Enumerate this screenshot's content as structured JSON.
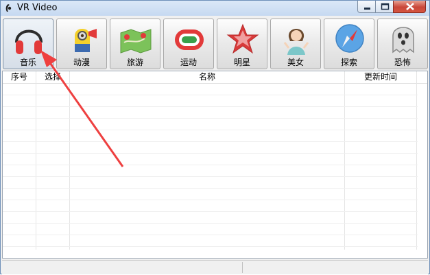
{
  "window": {
    "title": "VR Video"
  },
  "toolbar": {
    "buttons": [
      {
        "label": "音乐",
        "icon": "headphones-icon"
      },
      {
        "label": "动漫",
        "icon": "minion-icon"
      },
      {
        "label": "旅游",
        "icon": "map-icon"
      },
      {
        "label": "运动",
        "icon": "track-icon"
      },
      {
        "label": "明星",
        "icon": "star-icon"
      },
      {
        "label": "美女",
        "icon": "girl-icon"
      },
      {
        "label": "探索",
        "icon": "compass-icon"
      },
      {
        "label": "恐怖",
        "icon": "ghost-icon"
      }
    ]
  },
  "grid": {
    "columns": [
      "序号",
      "选择",
      "名称",
      "更新时间"
    ],
    "rows": []
  },
  "colors": {
    "accent_red": "#e23a3a",
    "title_bar": "#c6d9f1"
  }
}
